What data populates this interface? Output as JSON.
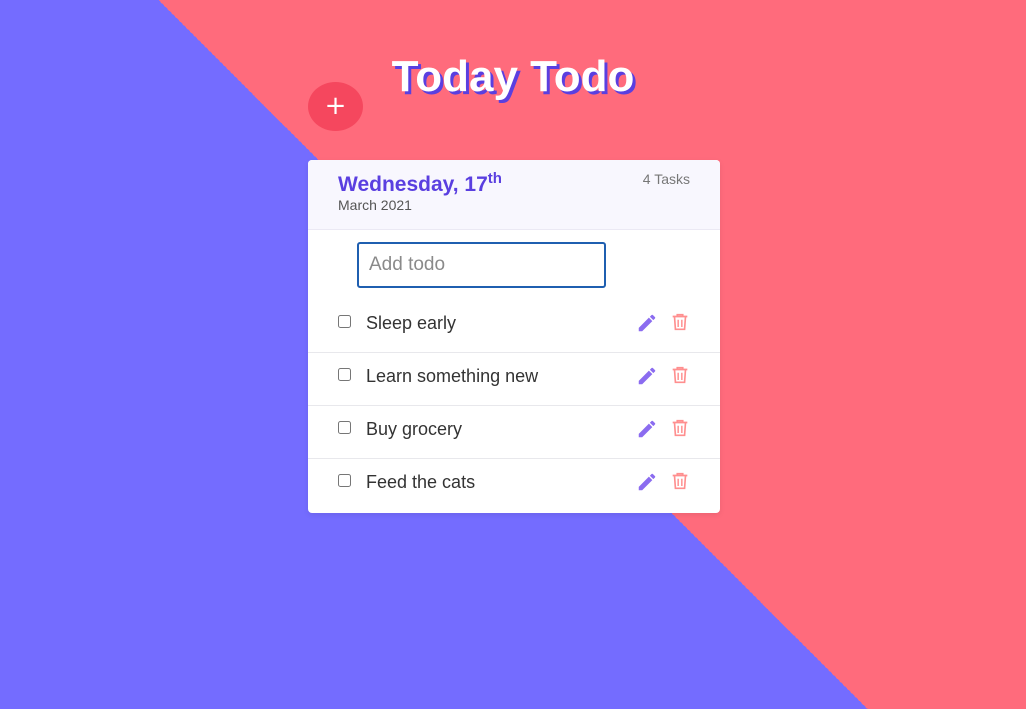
{
  "app": {
    "title": "Today Todo"
  },
  "header": {
    "weekday_day": "Wednesday, 17",
    "day_suffix": "th",
    "month_year": "March 2021",
    "task_count": "4 Tasks"
  },
  "add": {
    "placeholder": "Add todo",
    "value": "",
    "button_label": "+"
  },
  "todos": [
    {
      "text": "Sleep early",
      "checked": false
    },
    {
      "text": "Learn something new",
      "checked": false
    },
    {
      "text": "Buy grocery",
      "checked": false
    },
    {
      "text": "Feed the cats",
      "checked": false
    }
  ],
  "icons": {
    "edit": "pencil-icon",
    "delete": "trash-icon"
  },
  "colors": {
    "background_left": "#746cff",
    "background_right": "#ff6b7c",
    "accent": "#5a3fe0",
    "add_button": "#f5475e",
    "edit_icon": "#8b6cf0",
    "delete_icon": "#ff8f8f"
  }
}
